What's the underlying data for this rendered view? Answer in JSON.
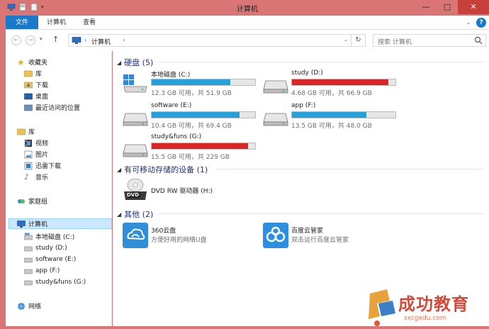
{
  "window": {
    "title": "计算机",
    "controls": {
      "minimize": "—",
      "maximize": "□",
      "close": "✕"
    }
  },
  "ribbon": {
    "tabs": [
      {
        "label": "文件",
        "active": true
      },
      {
        "label": "计算机",
        "active": false
      },
      {
        "label": "查看",
        "active": false
      }
    ],
    "help": "?"
  },
  "address": {
    "crumbs": [
      "计算机"
    ],
    "search_placeholder": "搜索 计算机"
  },
  "nav": {
    "items": [
      {
        "label": "收藏夹",
        "icon": "star-icon"
      },
      {
        "label": "库",
        "icon": "library-folder-icon"
      },
      {
        "label": "下载",
        "icon": "download-folder-icon"
      },
      {
        "label": "桌面",
        "icon": "desktop-icon"
      },
      {
        "label": "最近访问的位置",
        "icon": "recent-places-icon"
      },
      {
        "label": "库",
        "icon": "library-icon"
      },
      {
        "label": "视频",
        "icon": "video-icon"
      },
      {
        "label": "图片",
        "icon": "pictures-icon"
      },
      {
        "label": "迅雷下载",
        "icon": "thunder-download-icon"
      },
      {
        "label": "音乐",
        "icon": "music-icon"
      },
      {
        "label": "家庭组",
        "icon": "homegroup-icon"
      },
      {
        "label": "计算机",
        "icon": "computer-icon"
      },
      {
        "label": "本地磁盘 (C:)",
        "icon": "system-drive-icon"
      },
      {
        "label": "study (D:)",
        "icon": "drive-icon"
      },
      {
        "label": "software (E:)",
        "icon": "drive-icon"
      },
      {
        "label": "app (F:)",
        "icon": "drive-icon"
      },
      {
        "label": "study&funs (G:)",
        "icon": "drive-icon"
      },
      {
        "label": "网络",
        "icon": "network-icon"
      }
    ]
  },
  "groups": {
    "hard_disks": "硬盘 (5)",
    "removable": "有可移动存储的设备 (1)",
    "other": "其他 (2)"
  },
  "drives": [
    {
      "name": "本地磁盘 (C:)",
      "info": "12.3 GB 可用，共 51.9 GB",
      "used_fraction": 0.76,
      "color": "#26a0da",
      "system": true
    },
    {
      "name": "study (D:)",
      "info": "4.68 GB 可用，共 66.9 GB",
      "used_fraction": 0.93,
      "color": "#da2626",
      "system": false
    },
    {
      "name": "software (E:)",
      "info": "10.4 GB 可用，共 69.4 GB",
      "used_fraction": 0.85,
      "color": "#26a0da",
      "system": false
    },
    {
      "name": "app (F:)",
      "info": "13.5 GB 可用，共 48.0 GB",
      "used_fraction": 0.72,
      "color": "#26a0da",
      "system": false
    },
    {
      "name": "study&funs (G:)",
      "info": "15.5 GB 可用，共 229 GB",
      "used_fraction": 0.93,
      "color": "#da2626",
      "system": false
    }
  ],
  "removable": [
    {
      "name": "DVD RW 驱动器 (H:)",
      "icon_label": "DVD"
    }
  ],
  "apps": [
    {
      "name": "360云盘",
      "desc": "方便好用的网络U盘",
      "color": "#2f8fd8"
    },
    {
      "name": "百度云管家",
      "desc": "双击运行百度云管家",
      "color": "#2d8fe0"
    }
  ],
  "watermark": {
    "text": "成功教育",
    "url": "sxcgedu.com"
  }
}
